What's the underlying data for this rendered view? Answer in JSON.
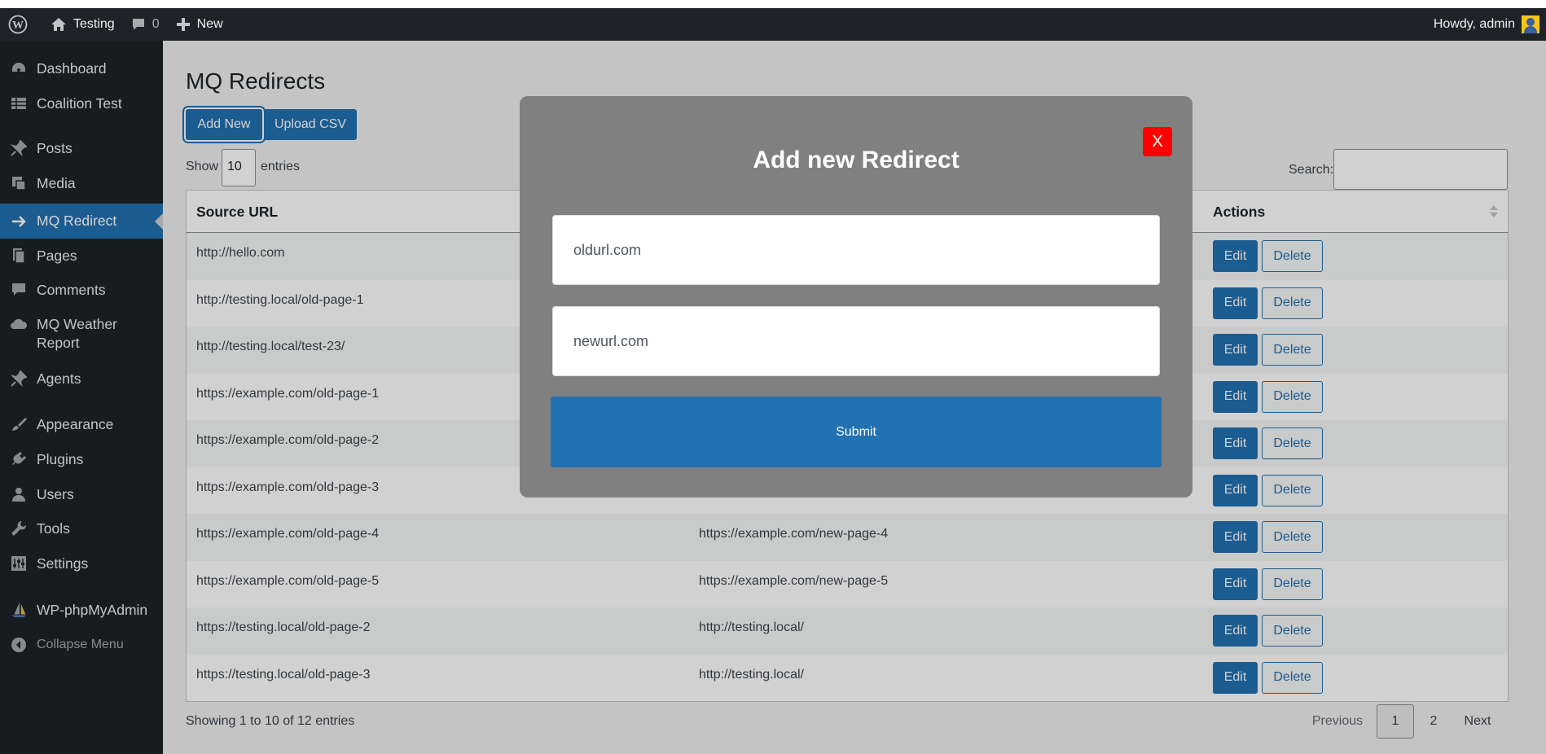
{
  "adminbar": {
    "site_name": "Testing",
    "comments_count": "0",
    "new_label": "New",
    "greeting": "Howdy, admin"
  },
  "sidebar": {
    "items": [
      {
        "label": "Dashboard",
        "icon": "dashboard-icon"
      },
      {
        "label": "Coalition Test",
        "icon": "table-icon"
      },
      {
        "label": "Posts",
        "icon": "pin-icon"
      },
      {
        "label": "Media",
        "icon": "media-icon"
      },
      {
        "label": "MQ Redirect",
        "icon": "arrow-right-icon"
      },
      {
        "label": "Pages",
        "icon": "pages-icon"
      },
      {
        "label": "Comments",
        "icon": "comment-icon"
      },
      {
        "label": "MQ Weather",
        "label2": "Report",
        "icon": "cloud-icon"
      },
      {
        "label": "Agents",
        "icon": "pin-icon"
      },
      {
        "label": "Appearance",
        "icon": "brush-icon"
      },
      {
        "label": "Plugins",
        "icon": "plugin-icon"
      },
      {
        "label": "Users",
        "icon": "user-icon"
      },
      {
        "label": "Tools",
        "icon": "wrench-icon"
      },
      {
        "label": "Settings",
        "icon": "settings-icon"
      },
      {
        "label": "WP-phpMyAdmin",
        "icon": "sailboat-icon"
      },
      {
        "label": "Collapse Menu",
        "icon": "collapse-icon"
      }
    ]
  },
  "main": {
    "title": "MQ Redirects",
    "add_new": "Add New",
    "upload_csv": "Upload CSV",
    "show": "Show",
    "page_length": "10",
    "entries": "entries",
    "search_label": "Search:",
    "search_value": "",
    "columns": {
      "source": "Source URL",
      "actions": "Actions"
    },
    "rows": [
      {
        "source": "http://hello.com",
        "target": ""
      },
      {
        "source": "http://testing.local/old-page-1",
        "target": ""
      },
      {
        "source": "http://testing.local/test-23/",
        "target": ""
      },
      {
        "source": "https://example.com/old-page-1",
        "target": ""
      },
      {
        "source": "https://example.com/old-page-2",
        "target": ""
      },
      {
        "source": "https://example.com/old-page-3",
        "target": ""
      },
      {
        "source": "https://example.com/old-page-4",
        "target": "https://example.com/new-page-4"
      },
      {
        "source": "https://example.com/old-page-5",
        "target": "https://example.com/new-page-5"
      },
      {
        "source": "https://testing.local/old-page-2",
        "target": "http://testing.local/"
      },
      {
        "source": "https://testing.local/old-page-3",
        "target": "http://testing.local/"
      }
    ],
    "edit_label": "Edit",
    "delete_label": "Delete",
    "showing": "Showing 1 to 10 of 12 entries",
    "pagination": {
      "previous": "Previous",
      "page1": "1",
      "page2": "2",
      "next": "Next"
    }
  },
  "modal": {
    "title": "Add new Redirect",
    "close": "X",
    "old_url_value": "oldurl.com",
    "new_url_value": "newurl.com",
    "submit": "Submit"
  },
  "colors": {
    "primary": "#2271b1",
    "sidebar": "#1d2327",
    "modal": "#808080",
    "close": "#ff0000"
  }
}
